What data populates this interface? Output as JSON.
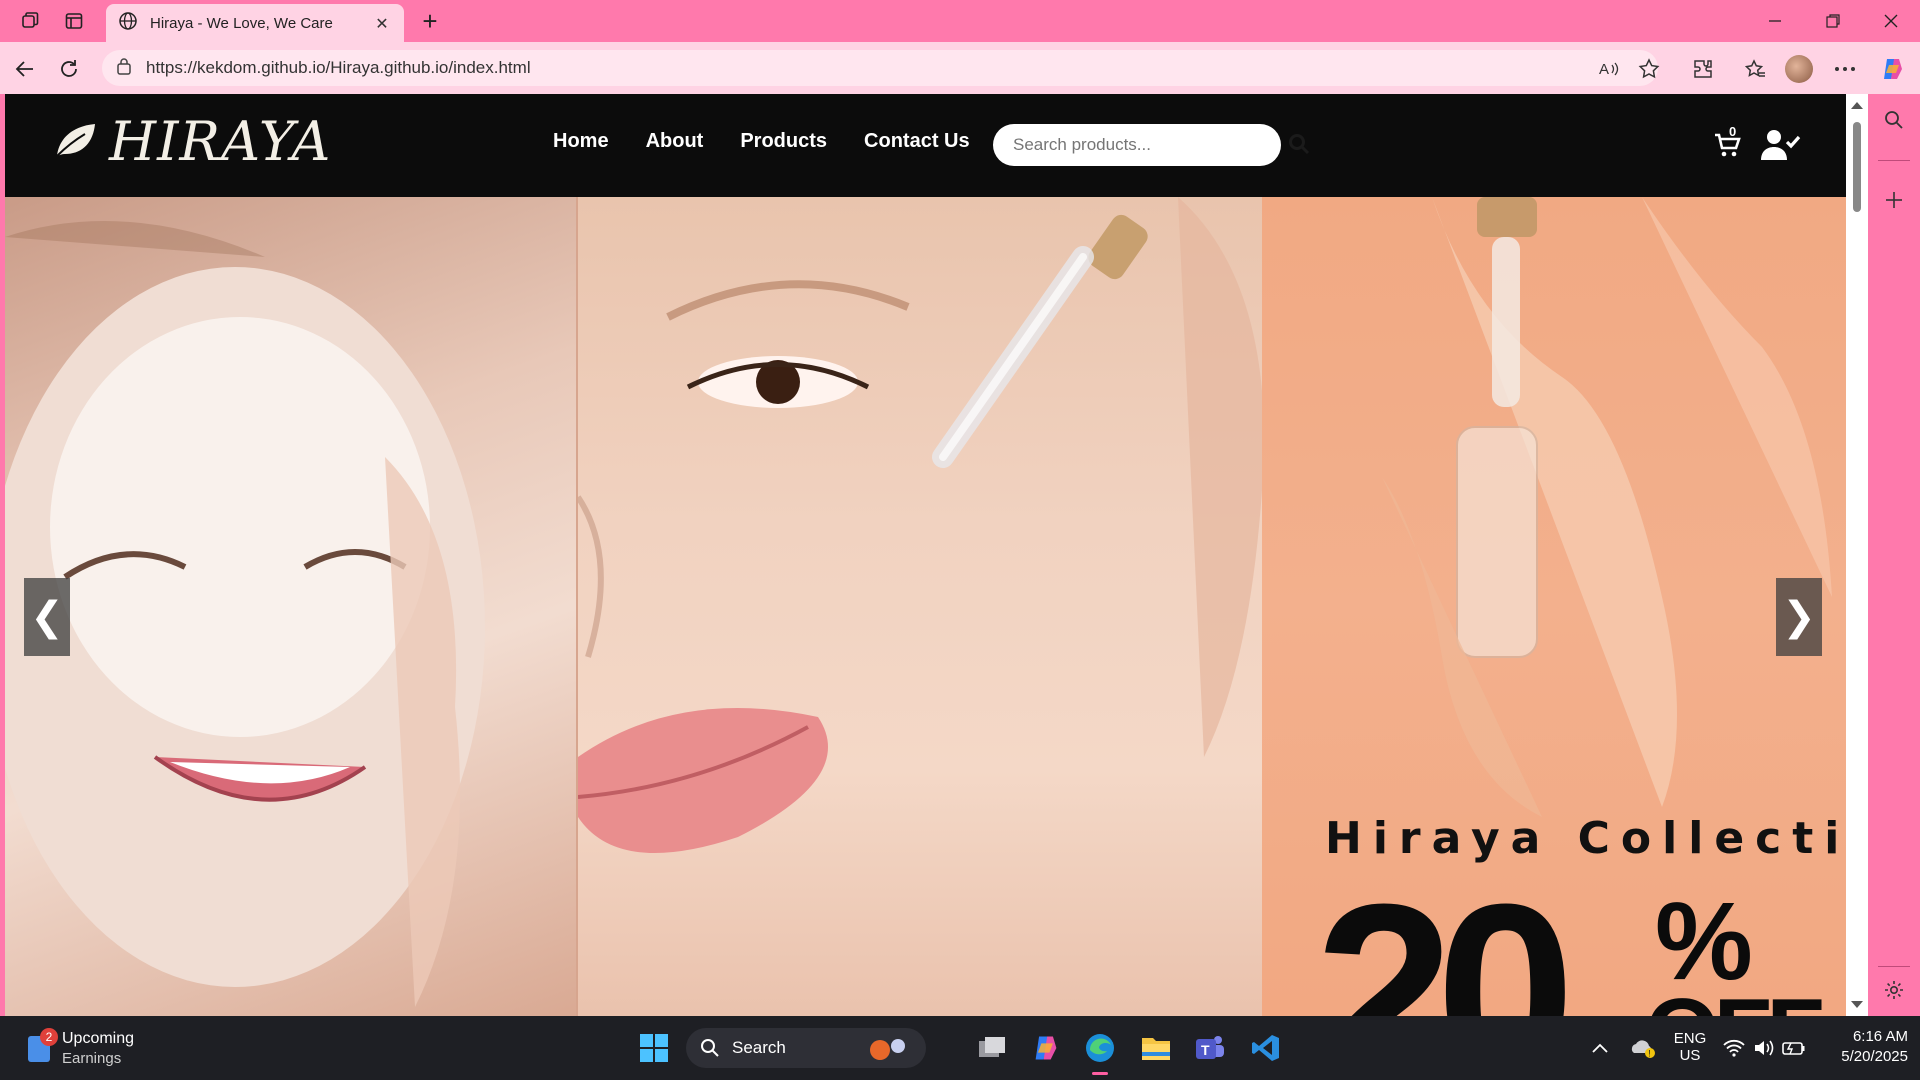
{
  "browser": {
    "tab_title": "Hiraya - We Love, We Care",
    "url": "https://kekdom.github.io/Hiraya.github.io/index.html"
  },
  "site": {
    "logo_text": "HIRAYA",
    "nav": [
      {
        "label": "Home"
      },
      {
        "label": "About"
      },
      {
        "label": "Products"
      },
      {
        "label": "Contact Us"
      }
    ],
    "search_placeholder": "Search products...",
    "cart_count": "0"
  },
  "hero": {
    "prev_label": "❮",
    "next_label": "❯",
    "promo_title": "Hiraya Collecti",
    "promo_number": "20",
    "promo_percent": "%",
    "promo_off": "OFF"
  },
  "taskbar": {
    "widget_badge": "2",
    "widget_title": "Upcoming",
    "widget_subtitle": "Earnings",
    "search_label": "Search",
    "lang_top": "ENG",
    "lang_bottom": "US",
    "time": "6:16 AM",
    "date": "5/20/2025"
  },
  "colors": {
    "chrome_pink": "#ff79ac",
    "header_black": "#0c0c0c",
    "taskbar": "#1e1f24"
  }
}
